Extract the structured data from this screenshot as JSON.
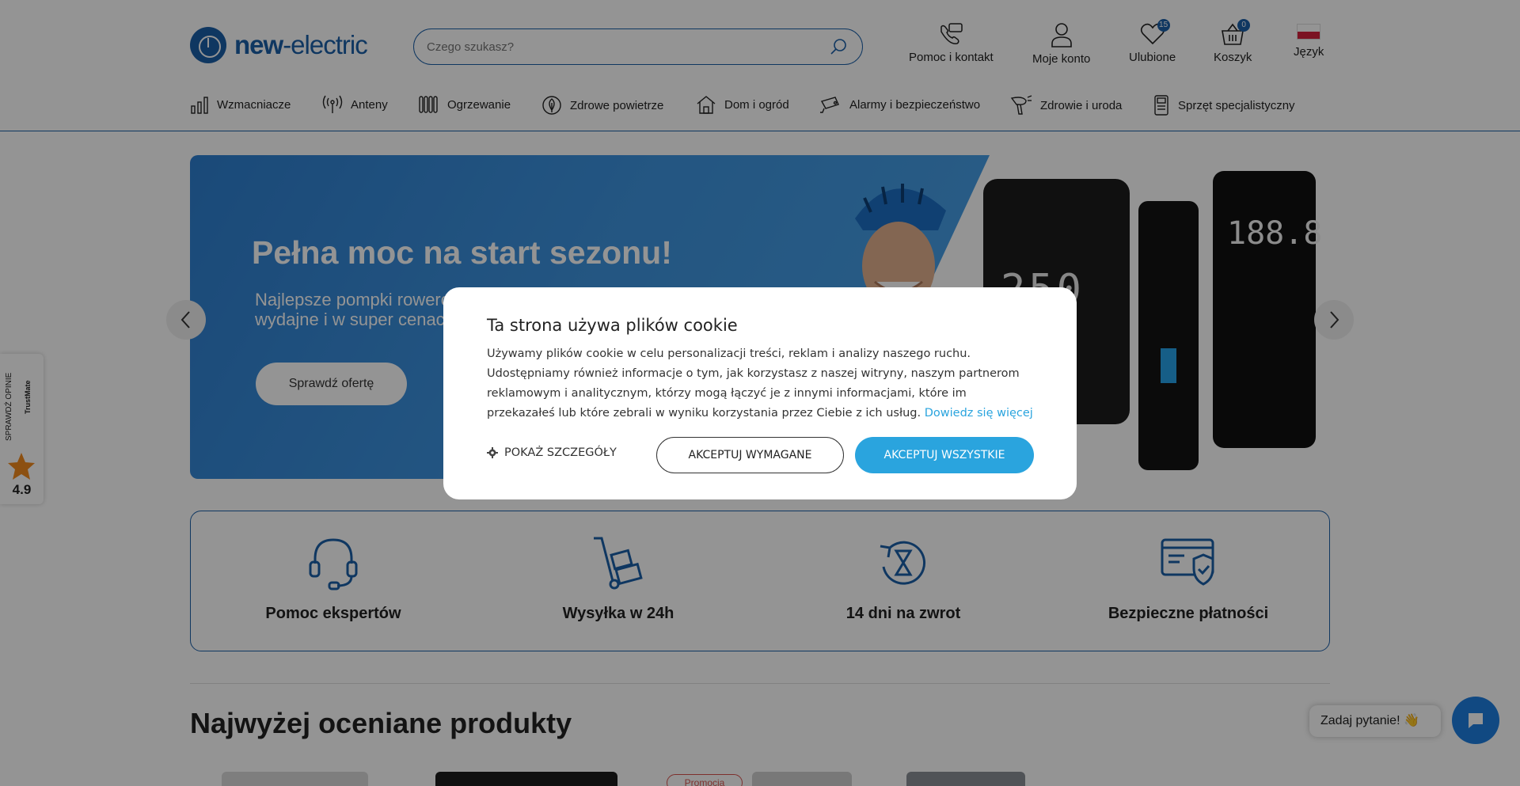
{
  "header": {
    "logo_bold": "new",
    "logo_rest": "-electric",
    "search_placeholder": "Czego szukasz?",
    "actions": {
      "help": "Pomoc i kontakt",
      "account": "Moje konto",
      "favorites": "Ulubione",
      "favorites_count": "15",
      "cart": "Koszyk",
      "cart_count": "0",
      "language": "Język"
    }
  },
  "nav": {
    "items": [
      {
        "label": "Wzmacniacze",
        "icon": "amplifier-icon"
      },
      {
        "label": "Anteny",
        "icon": "antenna-icon"
      },
      {
        "label": "Ogrzewanie",
        "icon": "radiator-icon"
      },
      {
        "label": "Zdrowe powietrze",
        "icon": "leaf-icon"
      },
      {
        "label": "Dom i ogród",
        "icon": "house-icon"
      },
      {
        "label": "Alarmy i bezpieczeństwo",
        "icon": "camera-icon"
      },
      {
        "label": "Zdrowie i uroda",
        "icon": "hairdryer-icon"
      },
      {
        "label": "Sprzęt specjalistyczny",
        "icon": "device-icon"
      }
    ]
  },
  "banner": {
    "title": "Pełna moc na start sezonu!",
    "subtitle": "Najlepsze pompki rowerowe wydajne i w super cenach",
    "button": "Sprawdź ofertę",
    "device_display_1": "250",
    "device_display_2": "188.8"
  },
  "features": [
    {
      "label": "Pomoc ekspertów",
      "icon": "headset-icon"
    },
    {
      "label": "Wysyłka w 24h",
      "icon": "hand-truck-icon"
    },
    {
      "label": "14 dni na zwrot",
      "icon": "hourglass-return-icon"
    },
    {
      "label": "Bezpieczne płatności",
      "icon": "secure-card-icon"
    }
  ],
  "section": {
    "title": "Najwyżej oceniane produkty",
    "promo_tag": "Promocja"
  },
  "trustmate": {
    "label": "SPRAWDŹ OPINIE",
    "brand": "TrustMate",
    "score": "4.9"
  },
  "chat": {
    "bubble": "Zadaj pytanie! 👋"
  },
  "cookie": {
    "title": "Ta strona używa plików cookie",
    "text": "Używamy plików cookie w celu personalizacji treści, reklam i analizy naszego ruchu. Udostępniamy również informacje o tym, jak korzystasz z naszej witryny, naszym partnerom reklamowym i analitycznym, którzy mogą łączyć je z innymi informacjami, które im przekazałeś lub które zebrali w wyniku korzystania przez Ciebie z ich usług.",
    "link": "Dowiedz się więcej",
    "details": "POKAŻ SZCZEGÓŁY",
    "accept_required": "AKCEPTUJ WYMAGANE",
    "accept_all": "AKCEPTUJ WSZYSTKIE"
  },
  "colors": {
    "brand": "#1b5fa8",
    "accent": "#2aa4de",
    "chat": "#1e7fe0"
  }
}
